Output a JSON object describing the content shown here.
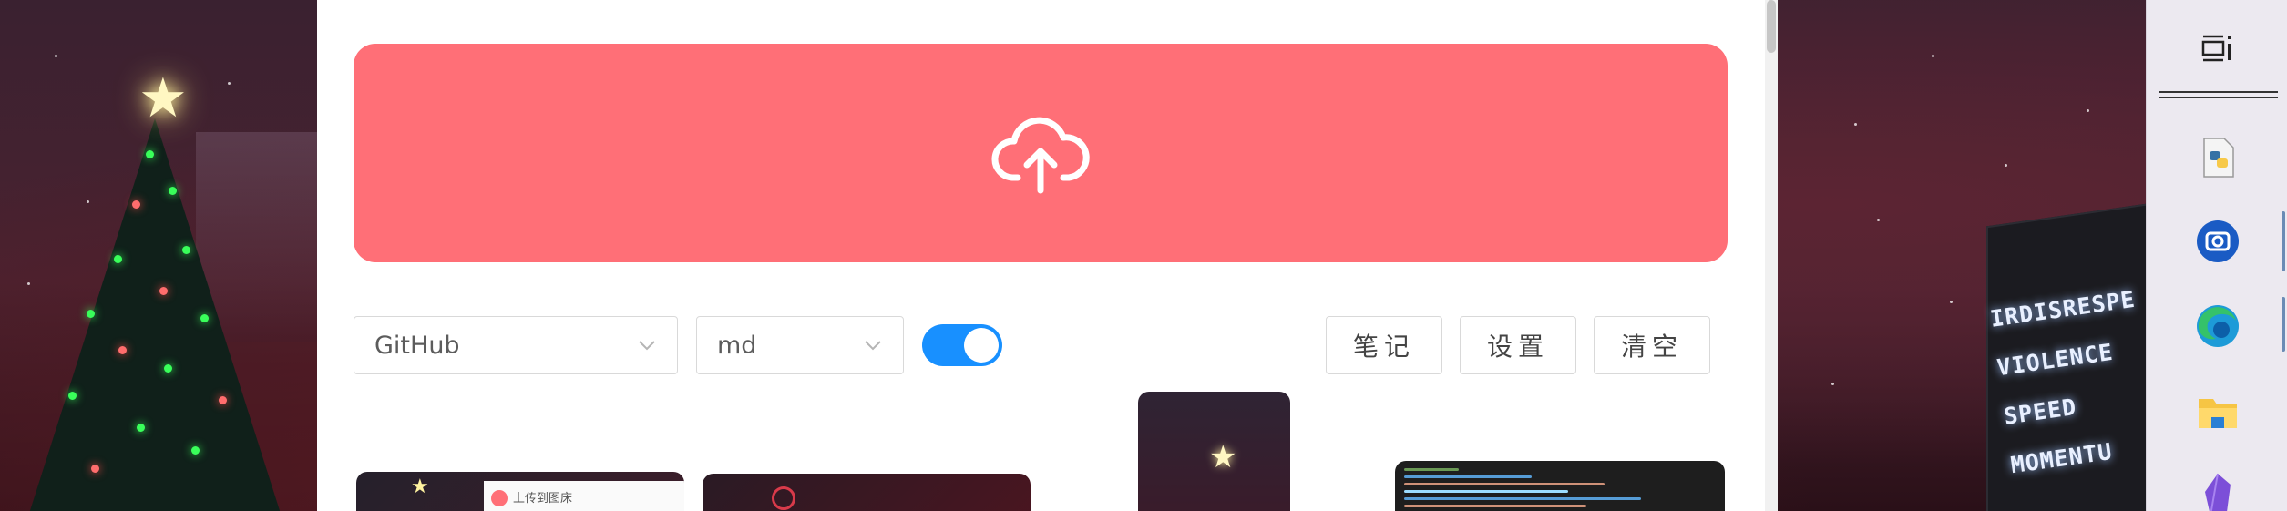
{
  "app": {
    "upload_zone": {
      "icon": "cloud-upload-icon",
      "color": "#ff6f77"
    },
    "platform_select": {
      "value": "GitHub",
      "icon": "chevron-down-icon"
    },
    "format_select": {
      "value": "md",
      "icon": "chevron-down-icon"
    },
    "toggle": {
      "checked": true,
      "color": "#1890ff"
    },
    "buttons": {
      "notes_label": "笔记",
      "settings_label": "设置",
      "clear_label": "清空"
    },
    "thumbnails": [
      {
        "kind": "screenshot",
        "dialog_text": "上传到图床"
      },
      {
        "kind": "screenshot"
      },
      {
        "kind": "image"
      },
      {
        "kind": "code-screenshot"
      }
    ]
  },
  "wallpaper": {
    "monolith_text": [
      "IRDISRESPE",
      "VIOLENCE",
      "SPEED",
      "MOMENTU"
    ]
  },
  "taskbar": {
    "items": [
      {
        "icon": "taskbar-menu-icon"
      },
      {
        "icon": "python-file-icon"
      },
      {
        "icon": "camera-app-icon"
      },
      {
        "icon": "edge-browser-icon"
      },
      {
        "icon": "file-explorer-icon"
      },
      {
        "icon": "obsidian-icon"
      }
    ]
  }
}
